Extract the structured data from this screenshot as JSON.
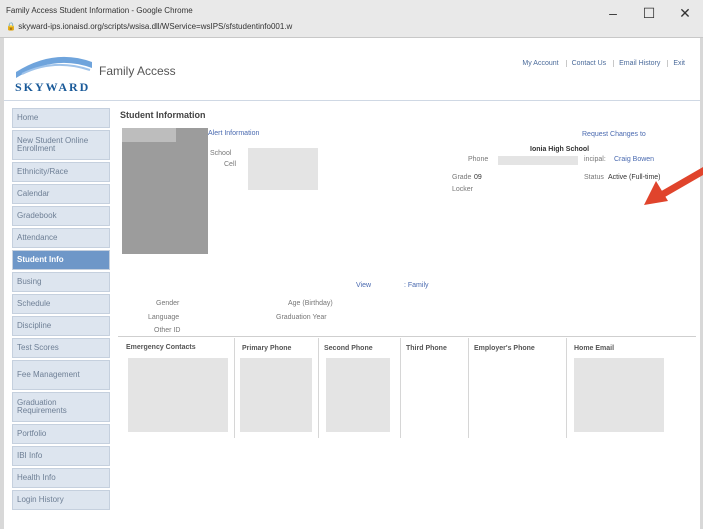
{
  "browser": {
    "title": "Family Access Student Information - Google Chrome",
    "url": "skyward-ips.ionaisd.org/scripts/wsisa.dll/WService=wsIPS/sfstudentinfo001.w",
    "minimize": "–",
    "maximize": "☐",
    "close": "✕"
  },
  "header": {
    "brand": "SKYWARD",
    "app_title": "Family Access",
    "links": [
      "My Account",
      "Contact Us",
      "Email History",
      "Exit"
    ]
  },
  "sidebar": {
    "items": [
      {
        "label": "Home"
      },
      {
        "label": "New Student Online Enrollment"
      },
      {
        "label": "Ethnicity/Race"
      },
      {
        "label": "Calendar"
      },
      {
        "label": "Gradebook"
      },
      {
        "label": "Attendance"
      },
      {
        "label": "Student Info"
      },
      {
        "label": "Busing"
      },
      {
        "label": "Schedule"
      },
      {
        "label": "Discipline"
      },
      {
        "label": "Test Scores"
      },
      {
        "label": "Fee Management"
      },
      {
        "label": "Graduation Requirements"
      },
      {
        "label": "Portfolio"
      },
      {
        "label": "IBI Info"
      },
      {
        "label": "Health Info"
      },
      {
        "label": "Login History"
      }
    ],
    "active_index": 6
  },
  "student": {
    "section_title": "Student Information",
    "alert_link": "Alert Information",
    "request_changes": "Request Changes to",
    "school_label": "School",
    "cell_label": "Cell",
    "school_value": "Ionia High School",
    "phone_label": "Phone",
    "principal_label": "incipal:",
    "principal_value": "Craig Bowen",
    "grade_label": "Grade",
    "grade_value": "09",
    "status_label": "Status",
    "status_value": "Active (Full-time)",
    "locker_label": "Locker",
    "view_label": "View",
    "family_link": ": Family",
    "gender_label": "Gender",
    "age_label": "Age (Birthday)",
    "language_label": "Language",
    "grad_year_label": "Graduation Year",
    "other_id_label": "Other ID"
  },
  "contacts": {
    "columns": [
      "Emergency Contacts",
      "Primary Phone",
      "Second Phone",
      "Third Phone",
      "Employer's Phone",
      "Home Email"
    ]
  }
}
